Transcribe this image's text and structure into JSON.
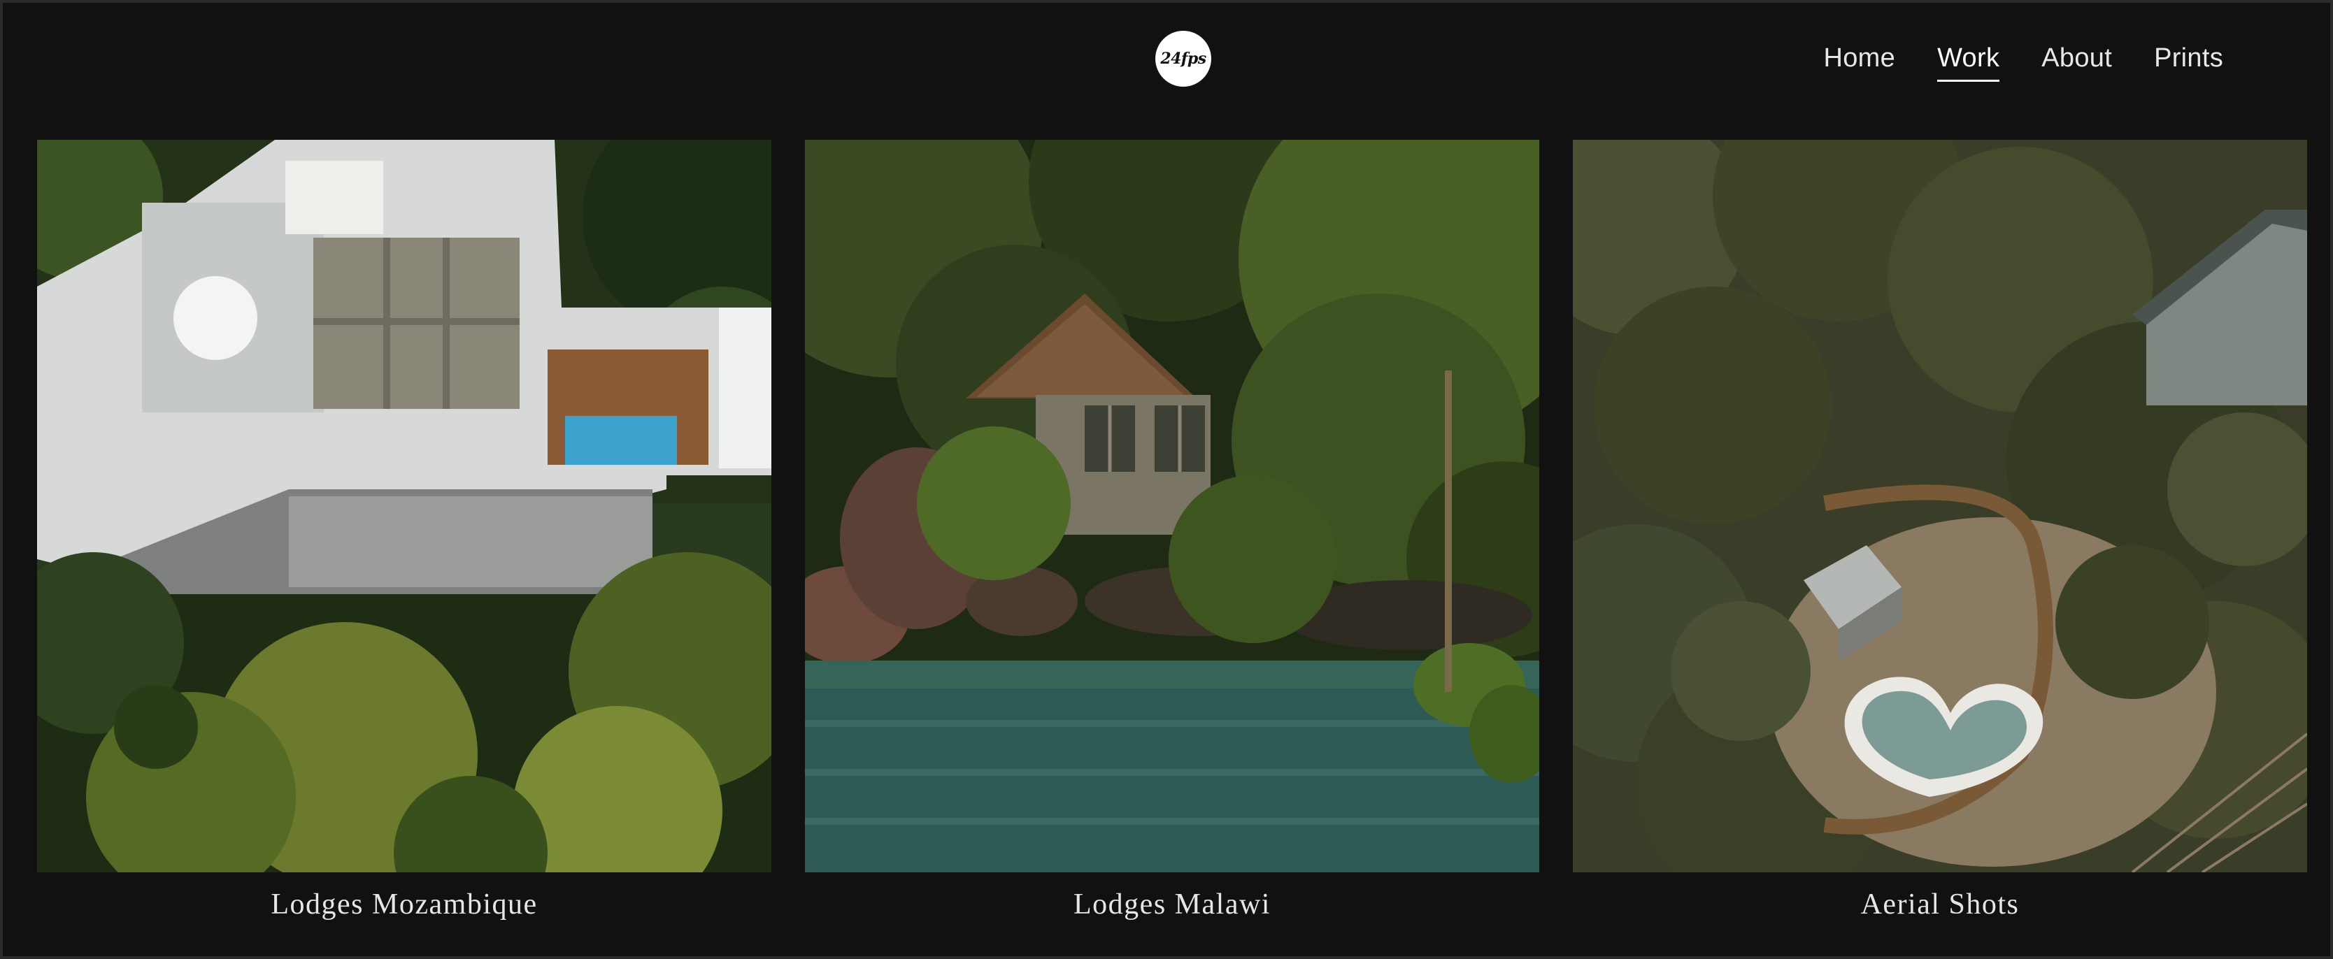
{
  "header": {
    "logo_text": "24fps",
    "nav": [
      {
        "label": "Home",
        "active": false
      },
      {
        "label": "Work",
        "active": true
      },
      {
        "label": "About",
        "active": false
      },
      {
        "label": "Prints",
        "active": false
      }
    ]
  },
  "gallery": [
    {
      "caption": "Lodges Mozambique",
      "image": "aerial-view-white-lodge-with-pool-and-palm-trees"
    },
    {
      "caption": "Lodges Malawi",
      "image": "thatched-stone-hut-among-trees-by-lake"
    },
    {
      "caption": "Aerial Shots",
      "image": "aerial-heart-shaped-pool-surrounded-by-bush"
    }
  ],
  "colors": {
    "background": "#111111",
    "nav_text": "#e8e8e8",
    "caption_text": "#e6e6e6",
    "logo_bg": "#ffffff"
  }
}
